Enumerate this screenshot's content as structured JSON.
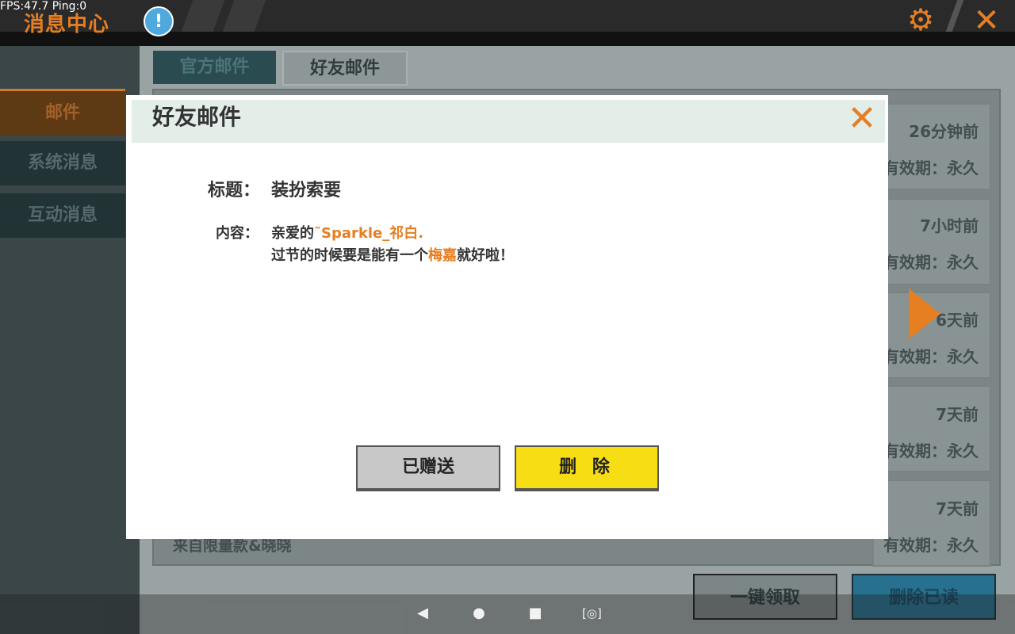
{
  "hud": {
    "fps": "FPS:47.7",
    "ping": "Ping:0"
  },
  "header": {
    "title": "消息中心",
    "notice_symbol": "!"
  },
  "sidebar": {
    "items": [
      {
        "label": "邮件",
        "active": true
      },
      {
        "label": "系统消息"
      },
      {
        "label": "互动消息"
      }
    ]
  },
  "tabs": [
    {
      "label": "官方邮件"
    },
    {
      "label": "好友邮件",
      "active": true
    }
  ],
  "mail_list": [
    {
      "time": "26分钟前",
      "expire": "有效期：永久"
    },
    {
      "time": "7小时前",
      "expire": "有效期：永久"
    },
    {
      "time": "6天前",
      "expire": "有效期：永久"
    },
    {
      "time": "7天前",
      "expire": "有效期：永久"
    },
    {
      "time": "7天前",
      "expire": "有效期：永久",
      "from": "来自限量款&晓晓"
    }
  ],
  "bottom_buttons": {
    "claim_all": "一键领取",
    "delete_read": "删除已读"
  },
  "modal": {
    "title": "好友邮件",
    "subject_label": "标题：",
    "subject": "装扮索要",
    "content_label": "内容：",
    "content": {
      "greeting": "亲爱的",
      "recipient": "˜Sparkle_祁白.",
      "line2_prefix": "过节的时候要是能有一个",
      "item": "梅嘉",
      "line2_suffix": "就好啦！"
    },
    "buttons": {
      "sent": "已赠送",
      "delete": "删 除"
    }
  },
  "colors": {
    "accent": "#e67e22",
    "delete_button": "#f7dd14",
    "sent_button": "#c8c8c8"
  }
}
